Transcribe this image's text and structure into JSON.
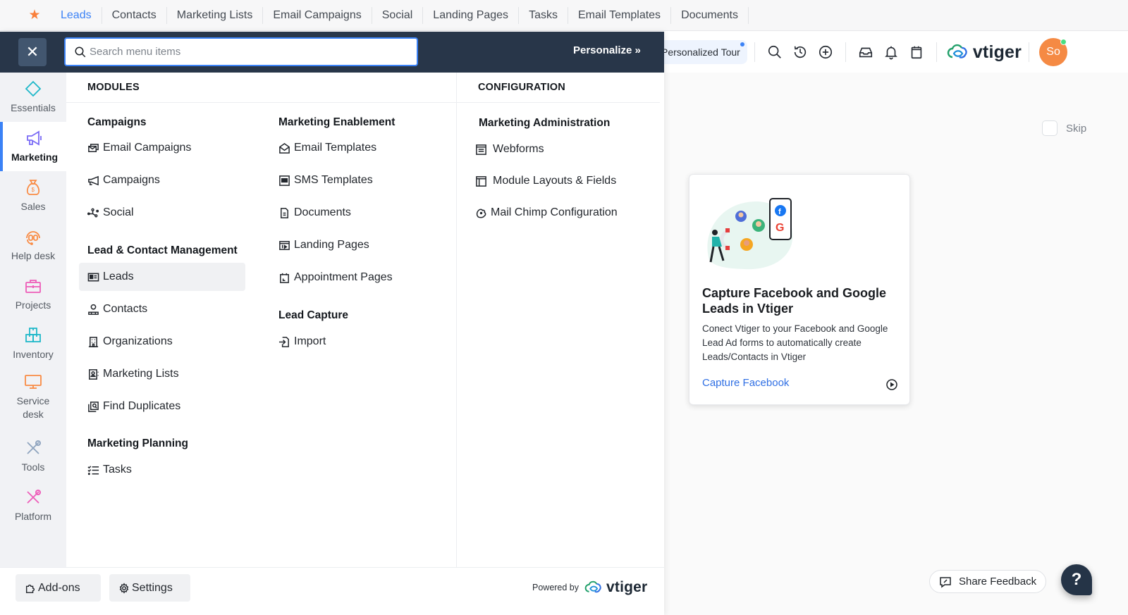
{
  "tabbar": {
    "favorite_icon": "star-icon",
    "tabs": [
      {
        "label": "Leads",
        "active": true
      },
      {
        "label": "Contacts"
      },
      {
        "label": "Marketing Lists"
      },
      {
        "label": "Email Campaigns"
      },
      {
        "label": "Social"
      },
      {
        "label": "Landing Pages"
      },
      {
        "label": "Tasks"
      },
      {
        "label": "Email Templates"
      },
      {
        "label": "Documents"
      }
    ]
  },
  "header": {
    "tour_label": "Personalized Tour",
    "icons": [
      "search-icon",
      "history-icon",
      "add-icon",
      "inbox-icon",
      "bell-icon",
      "calendar-icon"
    ],
    "brand": "vtiger",
    "avatar_initials": "So"
  },
  "menu": {
    "search": {
      "placeholder": "Search menu items",
      "value": ""
    },
    "personalize_label": "Personalize »",
    "rail": [
      {
        "label": "Essentials",
        "icon": "diamond-icon"
      },
      {
        "label": "Marketing",
        "icon": "megaphone-icon",
        "active": true
      },
      {
        "label": "Sales",
        "icon": "money-bag-icon"
      },
      {
        "label": "Help desk",
        "icon": "headset-icon"
      },
      {
        "label": "Projects",
        "icon": "briefcase-icon"
      },
      {
        "label": "Inventory",
        "icon": "boxes-icon"
      },
      {
        "label": "Service desk",
        "icon": "monitor-icon"
      },
      {
        "label": "Tools",
        "icon": "tools-icon"
      },
      {
        "label": "Platform",
        "icon": "platform-tools-icon"
      }
    ],
    "modules_header": "MODULES",
    "configuration_header": "CONFIGURATION",
    "groups": {
      "campaigns": {
        "title": "Campaigns",
        "items": [
          "Email Campaigns",
          "Campaigns",
          "Social"
        ]
      },
      "lead_contact": {
        "title": "Lead & Contact Management",
        "items": [
          "Leads",
          "Contacts",
          "Organizations",
          "Marketing Lists",
          "Find Duplicates"
        ]
      },
      "planning": {
        "title": "Marketing Planning",
        "items": [
          "Tasks"
        ]
      },
      "enablement": {
        "title": "Marketing Enablement",
        "items": [
          "Email Templates",
          "SMS Templates",
          "Documents",
          "Landing Pages",
          "Appointment Pages"
        ]
      },
      "lead_capture": {
        "title": "Lead Capture",
        "items": [
          "Import"
        ]
      },
      "administration": {
        "title": "Marketing Administration",
        "items": [
          "Webforms",
          "Module Layouts & Fields",
          "Mail Chimp Configuration"
        ]
      }
    },
    "selected_item": "Leads",
    "footer": {
      "addons_label": "Add-ons",
      "settings_label": "Settings",
      "powered_by": "Powered by",
      "brand": "vtiger"
    }
  },
  "content": {
    "skip_label": "Skip",
    "promo": {
      "title": "Capture Facebook and Google Leads in Vtiger",
      "description": "Conect Vtiger to your Facebook and Google Lead Ad forms to automatically create Leads/Contacts in Vtiger",
      "link_label": "Capture Facebook"
    },
    "feedback_label": "Share Feedback",
    "help_label": "?"
  },
  "colors": {
    "accent": "#3b82f6",
    "menu_header_bg": "#283649",
    "avatar_bg": "#f58a44",
    "link": "#2f6fe4"
  }
}
